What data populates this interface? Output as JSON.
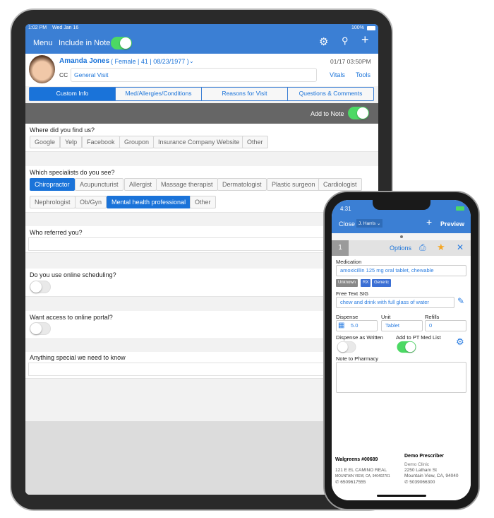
{
  "tablet": {
    "status": {
      "time": "1:02 PM",
      "date": "Wed Jan 16",
      "battery": "100%"
    },
    "nav": {
      "menu": "Menu",
      "include_label": "Include in Note",
      "include_on": true
    },
    "patient": {
      "name": "Amanda Jones",
      "details": "( Female | 41 | 08/23/1977 )",
      "timestamp": "01/17 03:50PM",
      "cc_label": "CC",
      "cc_value": "General Visit",
      "vitals": "Vitals",
      "tools": "Tools"
    },
    "tabs": [
      "Custom Info",
      "Med/Allergies/Conditions",
      "Reasons for Visit",
      "Questions & Comments"
    ],
    "active_tab": 0,
    "add_to_note": {
      "label": "Add to Note",
      "on": true
    },
    "q1": {
      "label": "Where did you find us?",
      "options": [
        "Google",
        "Yelp",
        "Facebook",
        "Groupon",
        "Insurance Company Website",
        "Other"
      ]
    },
    "q2": {
      "label": "Which specialists do you see?",
      "options": [
        "Chiropractor",
        "Acupuncturist",
        "Allergist",
        "Massage therapist",
        "Dermatologist",
        "Plastic surgeon",
        "Cardiologist",
        "Nephrologist",
        "Ob/Gyn",
        "Mental health professional",
        "Other"
      ],
      "selected": [
        "Chiropractor",
        "Mental health professional"
      ]
    },
    "q3": {
      "label": "Who referred you?",
      "value": ""
    },
    "q4": {
      "label": "Do you use online scheduling?",
      "on": false
    },
    "q5": {
      "label": "Want access to online portal?",
      "on": false
    },
    "q6": {
      "label": "Anything special we need to know",
      "value": ""
    }
  },
  "phone": {
    "status": {
      "time": "4:31"
    },
    "nav": {
      "close": "Close",
      "user": "J. Harris",
      "preview": "Preview"
    },
    "header": {
      "number": "1",
      "options": "Options"
    },
    "medication": {
      "label": "Medication",
      "value": "amoxicillin 125 mg oral tablet, chewable",
      "badges": [
        "Unknown",
        "RX",
        "Generic"
      ]
    },
    "sig": {
      "label": "Free Text SIG",
      "value": "chew and drink with full glass of water"
    },
    "dispense": {
      "label": "Dispense",
      "value": "5.0"
    },
    "unit": {
      "label": "Unit",
      "value": "Tablet"
    },
    "refills": {
      "label": "Refills",
      "value": "0"
    },
    "daw": {
      "label": "Dispense as Written",
      "on": false
    },
    "med_list": {
      "label": "Add to PT Med List",
      "on": true
    },
    "note": {
      "label": "Note to Pharmacy",
      "value": ""
    },
    "pharmacy": {
      "name": "Walgreens #00689",
      "address": "121 E EL CAMINO REAL",
      "city": "MOUNTAIN VIEW, CA, 940402701",
      "phone": "6509617555"
    },
    "prescriber": {
      "name": "Demo Prescriber",
      "clinic": "Demo Clinic",
      "address": "2250 Latham St",
      "city": "Mountain View, CA, 94040",
      "phone": "5039066300"
    }
  },
  "colors": {
    "accent": "#3b7fd4",
    "selected": "#1a73d9",
    "toggle_on": "#4cd964",
    "star": "#f5a623"
  }
}
